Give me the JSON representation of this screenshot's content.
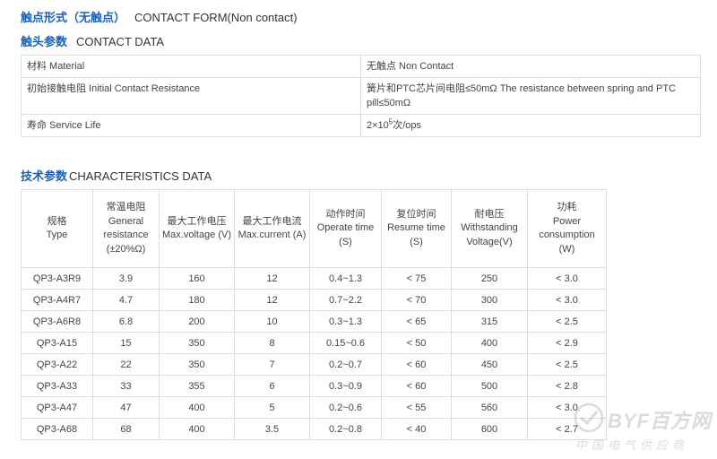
{
  "contact_form": {
    "cn": "触点形式（无触点）",
    "en": "CONTACT FORM(Non contact)"
  },
  "contact_data": {
    "cn": "触头参数",
    "en": "CONTACT DATA",
    "rows": [
      {
        "label": "材料 Material",
        "value": "无触点 Non Contact"
      },
      {
        "label": "初始接触电阻 Initial Contact Resistance",
        "value": "簧片和PTC芯片间电阻≤50mΩ The resistance between spring and PTC pill≤50mΩ"
      },
      {
        "label": "寿命 Service Life",
        "value_pre": "2×10",
        "value_sup": "5",
        "value_post": "次/ops"
      }
    ]
  },
  "characteristics": {
    "cn": "技术参数",
    "en": "CHARACTERISTICS DATA",
    "headers": [
      {
        "cn": "规格",
        "en": "Type"
      },
      {
        "cn": "常温电阻",
        "en": "General resistance (±20%Ω)"
      },
      {
        "cn": "最大工作电压",
        "en": "Max.voltage (V)"
      },
      {
        "cn": "最大工作电流",
        "en": "Max.current (A)"
      },
      {
        "cn": "动作时间",
        "en": "Operate time (S)"
      },
      {
        "cn": "复位时间",
        "en": "Resume time (S)"
      },
      {
        "cn": "耐电压",
        "en": "Withstanding Voltage(V)"
      },
      {
        "cn": "功耗",
        "en": "Power consumption (W)"
      }
    ],
    "rows": [
      [
        "QP3-A3R9",
        "3.9",
        "160",
        "12",
        "0.4~1.3",
        "< 75",
        "250",
        "< 3.0"
      ],
      [
        "QP3-A4R7",
        "4.7",
        "180",
        "12",
        "0.7~2.2",
        "< 70",
        "300",
        "< 3.0"
      ],
      [
        "QP3-A6R8",
        "6.8",
        "200",
        "10",
        "0.3~1.3",
        "< 65",
        "315",
        "< 2.5"
      ],
      [
        "QP3-A15",
        "15",
        "350",
        "8",
        "0.15~0.6",
        "< 50",
        "400",
        "< 2.9"
      ],
      [
        "QP3-A22",
        "22",
        "350",
        "7",
        "0.2~0.7",
        "< 60",
        "450",
        "< 2.5"
      ],
      [
        "QP3-A33",
        "33",
        "355",
        "6",
        "0.3~0.9",
        "< 60",
        "500",
        "< 2.8"
      ],
      [
        "QP3-A47",
        "47",
        "400",
        "5",
        "0.2~0.6",
        "< 55",
        "560",
        "< 3.0"
      ],
      [
        "QP3-A68",
        "68",
        "400",
        "3.5",
        "0.2~0.8",
        "< 40",
        "600",
        "< 2.7"
      ]
    ]
  },
  "watermark": {
    "logo": "BYF",
    "text": "BYF百方网",
    "sub": "中国电气供应商"
  }
}
